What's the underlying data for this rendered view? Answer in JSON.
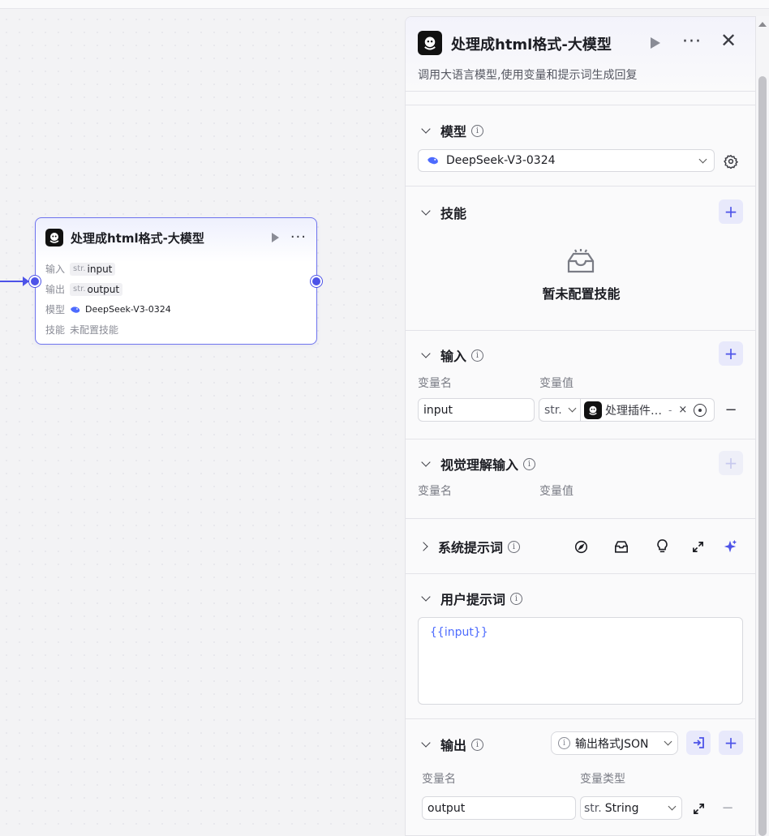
{
  "colors": {
    "accent": "#4d53e8",
    "edge": "#4d53e8"
  },
  "node": {
    "title": "处理成html格式-大模型",
    "rows": {
      "input_label": "输入",
      "input_type": "str.",
      "input_value": "input",
      "output_label": "输出",
      "output_type": "str.",
      "output_value": "output",
      "model_label": "模型",
      "model_value": "DeepSeek-V3-0324",
      "skill_label": "技能",
      "skill_value": "未配置技能"
    }
  },
  "panel": {
    "title": "处理成html格式-大模型",
    "description": "调用大语言模型,使用变量和提示词生成回复",
    "model": {
      "label": "模型",
      "selected": "DeepSeek-V3-0324"
    },
    "skills": {
      "label": "技能",
      "empty_text": "暂未配置技能"
    },
    "input": {
      "label": "输入",
      "col_name": "变量名",
      "col_value": "变量值",
      "var_name": "input",
      "type": "str.",
      "ref_text": "处理插件…",
      "ref_sep": "-"
    },
    "vision_input": {
      "label": "视觉理解输入",
      "col_name": "变量名",
      "col_value": "变量值"
    },
    "system_prompt": {
      "label": "系统提示词"
    },
    "user_prompt": {
      "label": "用户提示词",
      "content": "{{input}}"
    },
    "output": {
      "label": "输出",
      "format": "输出格式JSON",
      "col_name": "变量名",
      "col_type": "变量类型",
      "var_name": "output",
      "type_prefix": "str.",
      "type": "String"
    }
  }
}
